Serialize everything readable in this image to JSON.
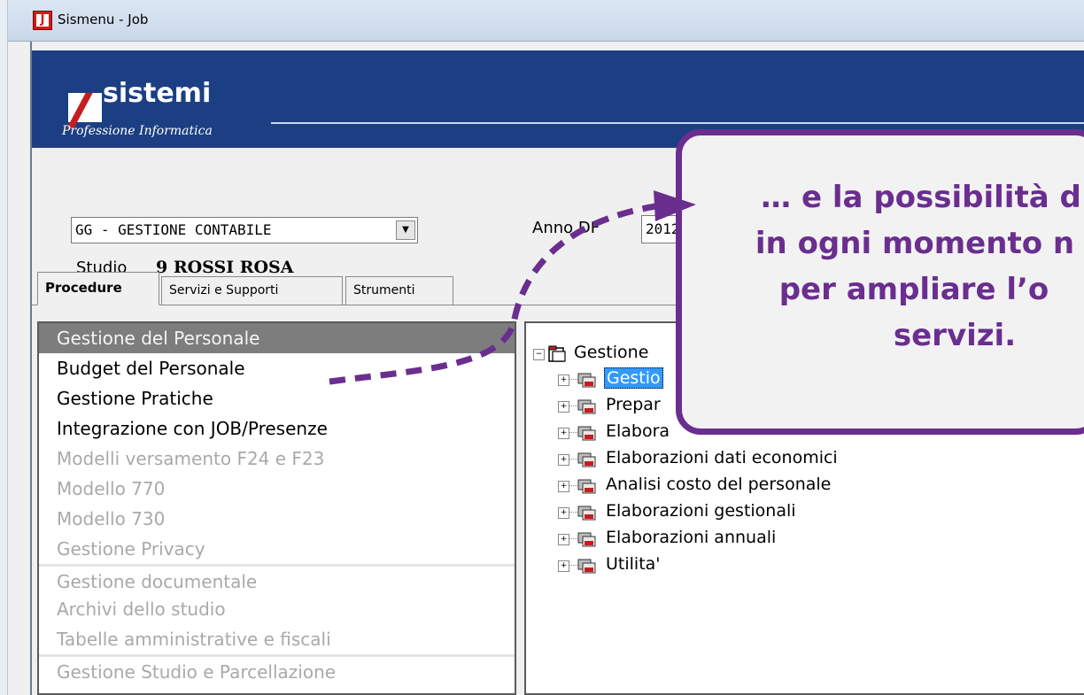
{
  "window": {
    "title": "Sismenu - Job",
    "icon": "J"
  },
  "logo": {
    "name": "sistemi",
    "tagline": "Professione Informatica"
  },
  "header": {
    "module_select": "GG - GESTIONE CONTABILE",
    "studio_label": "Studio",
    "studio_value": "9 ROSSI ROSA",
    "anno_label": "Anno DF",
    "anno_value": "2012"
  },
  "tabs": [
    {
      "label": "Procedure",
      "active": true
    },
    {
      "label": "Servizi e Supporti",
      "active": false
    },
    {
      "label": "Strumenti",
      "active": false
    }
  ],
  "procedures": [
    {
      "label": "Gestione del Personale",
      "state": "selected"
    },
    {
      "label": "Budget del Personale",
      "state": "enabled"
    },
    {
      "label": "Gestione Pratiche",
      "state": "enabled"
    },
    {
      "label": "Integrazione con JOB/Presenze",
      "state": "enabled"
    },
    {
      "label": "Modelli versamento F24 e F23",
      "state": "disabled"
    },
    {
      "label": "Modello 770",
      "state": "disabled"
    },
    {
      "label": "Modello 730",
      "state": "disabled"
    },
    {
      "label": "Gestione Privacy",
      "state": "disabled"
    },
    {
      "label": "Gestione documentale",
      "state": "disabled"
    },
    {
      "label": "Archivi dello studio",
      "state": "disabled"
    },
    {
      "label": "Tabelle amministrative e fiscali",
      "state": "disabled"
    },
    {
      "label": "Gestione Studio e Parcellazione",
      "state": "disabled"
    }
  ],
  "tree": {
    "root": "Gestione",
    "children": [
      {
        "label": "Gestio",
        "highlighted": true
      },
      {
        "label": "Prepar",
        "highlighted": false
      },
      {
        "label": "Elabora",
        "highlighted": false
      },
      {
        "label": "Elaborazioni dati economici",
        "highlighted": false
      },
      {
        "label": "Analisi costo del personale",
        "highlighted": false
      },
      {
        "label": "Elaborazioni gestionali",
        "highlighted": false
      },
      {
        "label": "Elaborazioni annuali",
        "highlighted": false
      },
      {
        "label": "Utilita'",
        "highlighted": false
      }
    ]
  },
  "callout": {
    "lines": [
      "… e la possibilità d",
      "in ogni momento n",
      "per ampliare l’o",
      "servizi."
    ]
  },
  "colors": {
    "banner": "#1c3f84",
    "callout_border": "#6a2e8f",
    "selection": "#3399ff"
  }
}
